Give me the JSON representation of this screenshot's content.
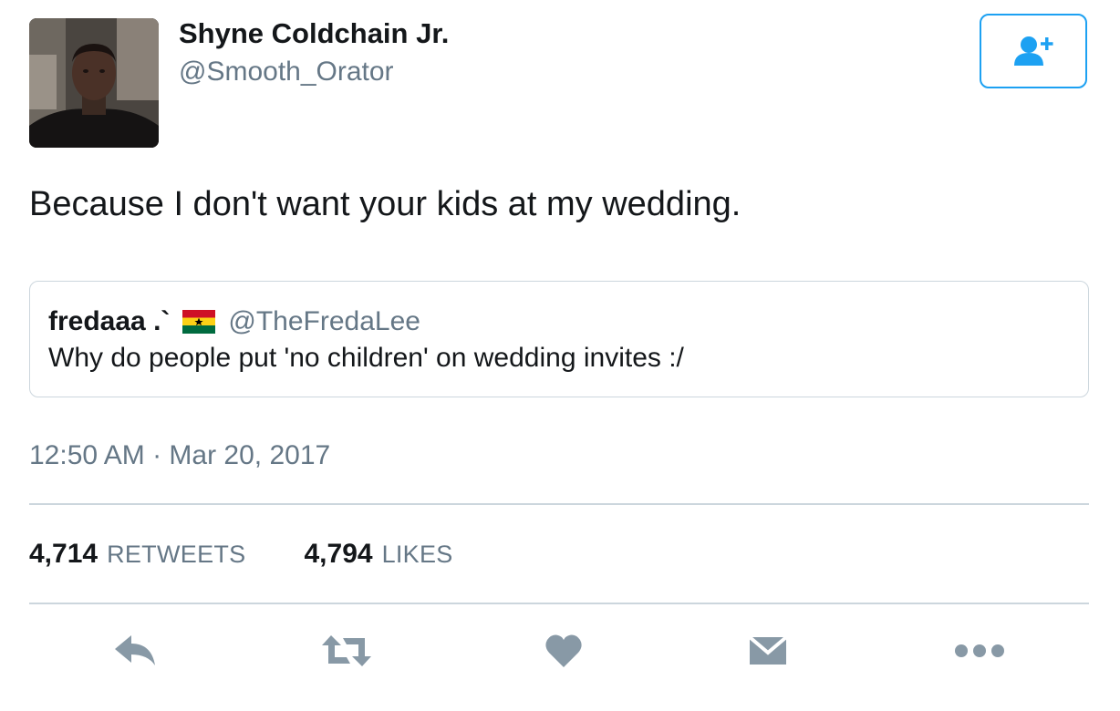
{
  "author": {
    "display_name": "Shyne Coldchain Jr.",
    "handle": "@Smooth_Orator",
    "avatar_icon": "profile-photo"
  },
  "follow_button": {
    "icon": "add-user-icon",
    "color": "#1da1f2"
  },
  "tweet": {
    "text": "Because I don't want your kids at my wedding.",
    "timestamp": "12:50 AM · Mar 20, 2017"
  },
  "quoted_tweet": {
    "display_name": "fredaaa .`",
    "flag_icon": "ghana-flag-icon",
    "handle": "@TheFredaLee",
    "text": "Why do people put 'no children' on wedding invites :/"
  },
  "stats": {
    "retweets_count": "4,714",
    "retweets_label": "RETWEETS",
    "likes_count": "4,794",
    "likes_label": "LIKES"
  },
  "actions": [
    {
      "icon": "reply-icon"
    },
    {
      "icon": "retweet-icon"
    },
    {
      "icon": "heart-icon"
    },
    {
      "icon": "envelope-icon"
    },
    {
      "icon": "more-icon"
    }
  ],
  "colors": {
    "text": "#14171a",
    "secondary": "#657786",
    "divider": "#ccd6dd",
    "action_icon": "#8899a6",
    "accent": "#1da1f2"
  }
}
